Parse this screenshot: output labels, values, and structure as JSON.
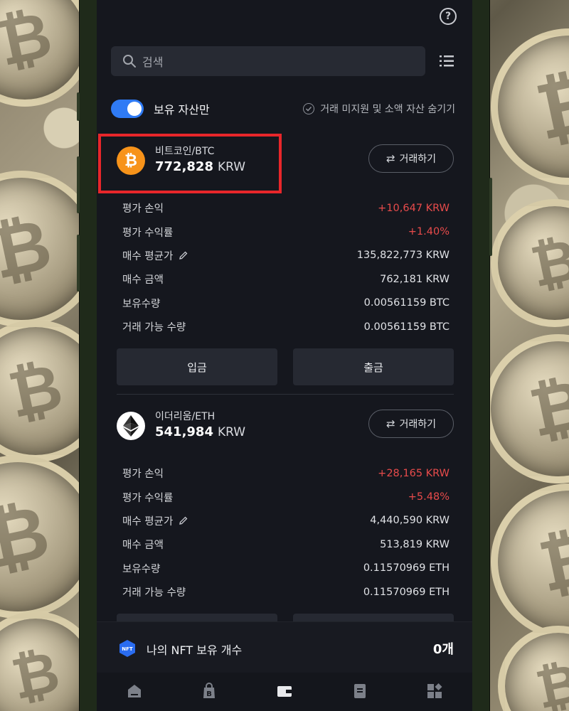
{
  "search": {
    "placeholder": "검색"
  },
  "filters": {
    "holdings_only_label": "보유 자산만",
    "holdings_only_on": true,
    "hide_small_label": "거래 미지원 및 소액 자산 숨기기"
  },
  "assets": [
    {
      "name": "비트코인/BTC",
      "value": "772,828",
      "currency": "KRW",
      "trade_label": "거래하기",
      "icon": "bitcoin-icon",
      "rows": [
        {
          "label": "평가 손익",
          "value": "+10,647 KRW",
          "positive": true
        },
        {
          "label": "평가 수익률",
          "value": "+1.40%",
          "positive": true
        },
        {
          "label": "매수 평균가",
          "value": "135,822,773 KRW"
        },
        {
          "label": "매수 금액",
          "value": "762,181 KRW"
        },
        {
          "label": "보유수량",
          "value": "0.00561159 BTC"
        },
        {
          "label": "거래 가능 수량",
          "value": "0.00561159 BTC"
        }
      ],
      "deposit_label": "입금",
      "withdraw_label": "출금"
    },
    {
      "name": "이더리움/ETH",
      "value": "541,984",
      "currency": "KRW",
      "trade_label": "거래하기",
      "icon": "ethereum-icon",
      "rows": [
        {
          "label": "평가 손익",
          "value": "+28,165 KRW",
          "positive": true
        },
        {
          "label": "평가 수익률",
          "value": "+5.48%",
          "positive": true
        },
        {
          "label": "매수 평균가",
          "value": "4,440,590 KRW"
        },
        {
          "label": "매수 금액",
          "value": "513,819 KRW"
        },
        {
          "label": "보유수량",
          "value": "0.11570969 ETH"
        },
        {
          "label": "거래 가능 수량",
          "value": "0.11570969 ETH"
        }
      ]
    }
  ],
  "nft": {
    "label": "나의 NFT 보유 개수",
    "count": "0개"
  },
  "colors": {
    "accent": "#2f7bf5",
    "profit": "#e84b4b",
    "highlight": "#e8262a",
    "btc": "#f7931a"
  }
}
